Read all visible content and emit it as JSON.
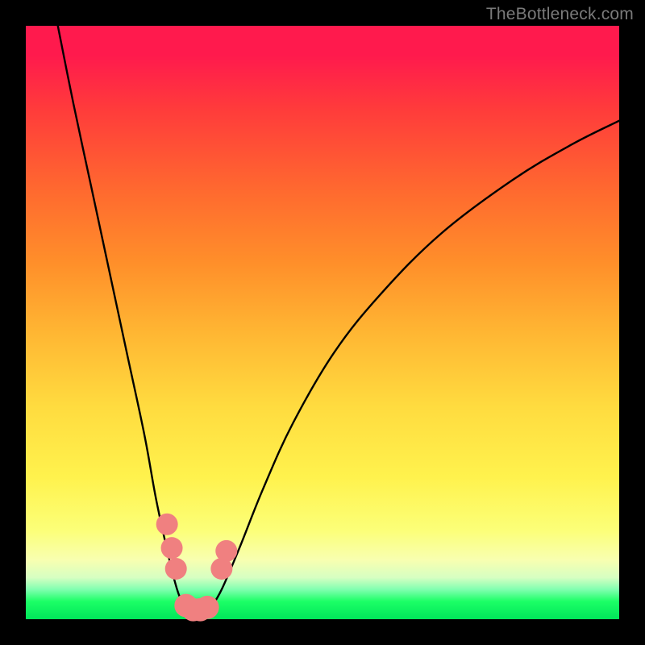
{
  "watermark": "TheBottleneck.com",
  "colors": {
    "frame": "#000000",
    "curve": "#000000",
    "dot": "#f08080",
    "gradient_stops": [
      {
        "pct": 0,
        "hex": "#ff1a4d"
      },
      {
        "pct": 5,
        "hex": "#ff1a4d"
      },
      {
        "pct": 14,
        "hex": "#ff3b3b"
      },
      {
        "pct": 28,
        "hex": "#ff6a2f"
      },
      {
        "pct": 40,
        "hex": "#ff8f2a"
      },
      {
        "pct": 52,
        "hex": "#ffb733"
      },
      {
        "pct": 64,
        "hex": "#ffdb3f"
      },
      {
        "pct": 76,
        "hex": "#fff24d"
      },
      {
        "pct": 85,
        "hex": "#fcff78"
      },
      {
        "pct": 90,
        "hex": "#f8ffb0"
      },
      {
        "pct": 93,
        "hex": "#d6ffc2"
      },
      {
        "pct": 95,
        "hex": "#80ffb0"
      },
      {
        "pct": 97,
        "hex": "#1cff66"
      },
      {
        "pct": 100,
        "hex": "#00e65a"
      }
    ]
  },
  "chart_data": {
    "type": "line",
    "title": "",
    "xlabel": "",
    "ylabel": "",
    "xlim": [
      0,
      100
    ],
    "ylim": [
      0,
      100
    ],
    "description": "Bottleneck curve: two branches descending from top into a narrow minimum near x≈27, then rising toward the right edge. Y-axis roughly maps to bottleneck percentage (0 at bottom/green, 100 at top/red). No numeric tick labels are shown in the image; all values are estimated from pixel positions.",
    "series": [
      {
        "name": "left_branch",
        "x": [
          5.0,
          8.0,
          11.0,
          14.0,
          17.0,
          20.0,
          22.0,
          24.2,
          25.5,
          26.5,
          27.3
        ],
        "y": [
          102.0,
          87.0,
          73.0,
          59.0,
          45.0,
          31.0,
          20.0,
          10.0,
          5.0,
          2.5,
          1.5
        ]
      },
      {
        "name": "floor",
        "x": [
          27.3,
          28.0,
          29.0,
          30.0,
          31.0
        ],
        "y": [
          1.5,
          1.2,
          1.2,
          1.3,
          1.6
        ]
      },
      {
        "name": "right_branch",
        "x": [
          31.0,
          33.0,
          36.0,
          40.0,
          45.0,
          52.0,
          60.0,
          70.0,
          82.0,
          92.0,
          100.0
        ],
        "y": [
          1.6,
          5.0,
          12.0,
          22.0,
          33.0,
          45.0,
          55.0,
          65.0,
          74.0,
          80.0,
          84.0
        ]
      }
    ],
    "markers": [
      {
        "x": 23.8,
        "y": 16.0,
        "r": 1.5
      },
      {
        "x": 24.6,
        "y": 12.0,
        "r": 1.5
      },
      {
        "x": 25.3,
        "y": 8.5,
        "r": 1.5
      },
      {
        "x": 27.0,
        "y": 2.3,
        "r": 1.6
      },
      {
        "x": 28.2,
        "y": 1.6,
        "r": 1.6
      },
      {
        "x": 29.4,
        "y": 1.6,
        "r": 1.6
      },
      {
        "x": 30.6,
        "y": 2.0,
        "r": 1.6
      },
      {
        "x": 33.0,
        "y": 8.5,
        "r": 1.5
      },
      {
        "x": 33.8,
        "y": 11.5,
        "r": 1.5
      }
    ]
  }
}
